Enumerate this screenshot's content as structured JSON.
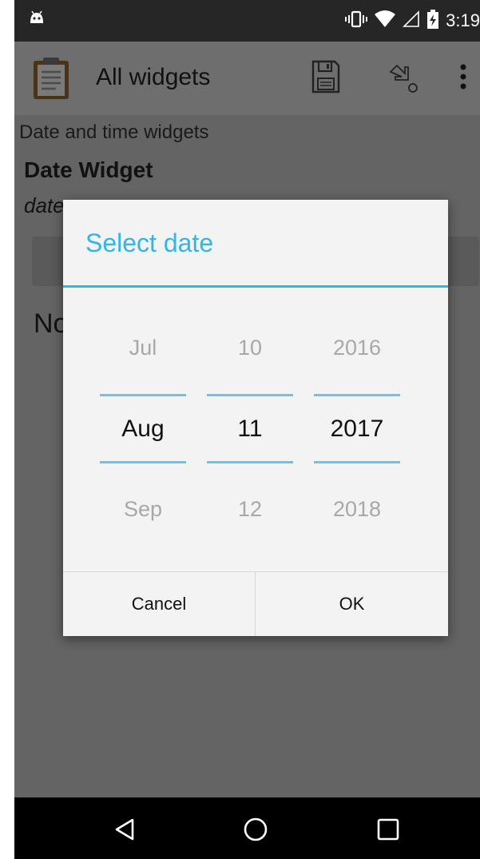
{
  "status_bar": {
    "time": "3:19"
  },
  "app_bar": {
    "title": "All widgets"
  },
  "content": {
    "group_label": "Date and time widgets",
    "question_title": "Date Widget",
    "question_hint": "date",
    "answer_text": "No"
  },
  "dialog": {
    "title": "Select date",
    "month": {
      "prev": "Jul",
      "current": "Aug",
      "next": "Sep"
    },
    "day": {
      "prev": "10",
      "current": "11",
      "next": "12"
    },
    "year": {
      "prev": "2016",
      "current": "2017",
      "next": "2018"
    },
    "cancel_label": "Cancel",
    "ok_label": "OK"
  },
  "colors": {
    "accent": "#33b5e5",
    "picker_line": "#6cc4e8",
    "scrim": "#646464"
  },
  "icons": [
    "android-icon",
    "vibrate-icon",
    "wifi-icon",
    "signal-icon",
    "battery-charging-icon",
    "clipboard-icon",
    "save-icon",
    "jump-icon",
    "more-vert-icon",
    "back-icon",
    "home-icon",
    "recents-icon"
  ]
}
